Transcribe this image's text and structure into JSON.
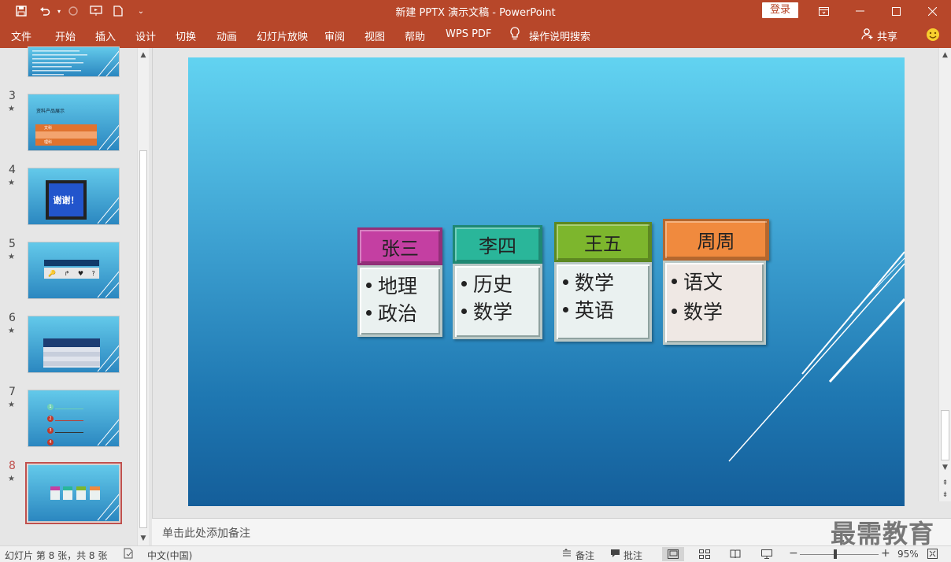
{
  "app": {
    "title": "新建 PPTX 演示文稿  -  PowerPoint",
    "login_label": "登录"
  },
  "menu": {
    "items": [
      "文件",
      "开始",
      "插入",
      "设计",
      "切换",
      "动画",
      "幻灯片放映",
      "审阅",
      "视图",
      "帮助",
      "WPS PDF",
      "操作说明搜索"
    ],
    "share_label": "共享"
  },
  "thumbnails": [
    {
      "num": "3",
      "star": "★",
      "title": "资料产品展示",
      "cells": [
        "文科",
        "理科"
      ]
    },
    {
      "num": "4",
      "star": "★",
      "text": "谢谢！"
    },
    {
      "num": "5",
      "star": "★",
      "symbols": [
        "🔑",
        "↱",
        "♥",
        "?"
      ]
    },
    {
      "num": "6",
      "star": "★"
    },
    {
      "num": "7",
      "star": "★",
      "markers": [
        "1",
        "2",
        "3",
        "4"
      ]
    },
    {
      "num": "8",
      "star": "★"
    }
  ],
  "slide": {
    "groups": [
      {
        "header": "张三",
        "items": [
          "地理",
          "政治"
        ],
        "color": "#c43fa2"
      },
      {
        "header": "李四",
        "items": [
          "历史",
          "数学"
        ],
        "color": "#2ab69a"
      },
      {
        "header": "王五",
        "items": [
          "数学",
          "英语"
        ],
        "color": "#7db62d"
      },
      {
        "header": "周周",
        "items": [
          "语文",
          "数学"
        ],
        "color": "#f08a3e"
      }
    ]
  },
  "notes": {
    "placeholder": "单击此处添加备注",
    "watermark": "最需教育"
  },
  "status": {
    "slide_info": "幻灯片 第 8 张，共 8 张",
    "language": "中文(中国)",
    "notes_label": "备注",
    "comments_label": "批注",
    "zoom": "95%"
  },
  "colors": {
    "ribbon": "#b7472a",
    "selected_border": "#c0504d"
  }
}
